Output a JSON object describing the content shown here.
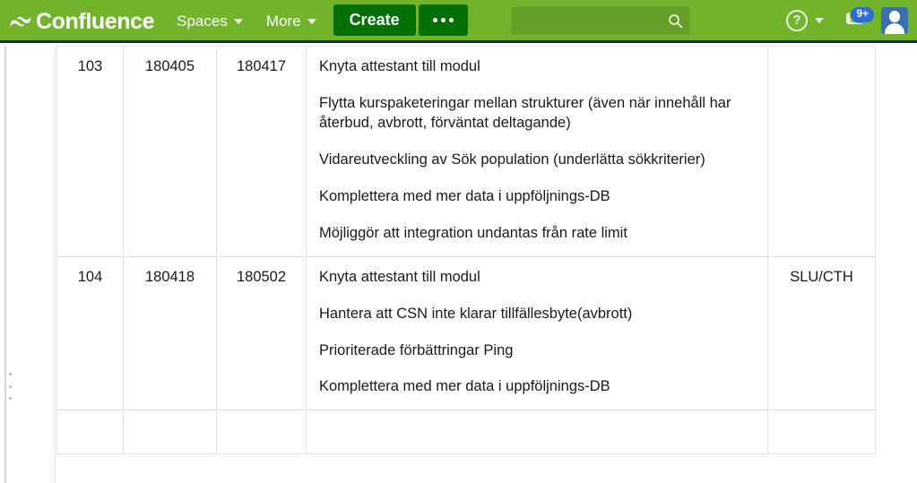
{
  "appbar": {
    "product_name": "Confluence",
    "logo_icon": "confluence-logo-icon",
    "nav": [
      {
        "label": "Spaces",
        "icon": "chevron-down-icon"
      },
      {
        "label": "More",
        "icon": "chevron-down-icon"
      }
    ],
    "create_label": "Create",
    "more_actions_icon": "ellipsis-icon",
    "search": {
      "value": "",
      "placeholder": "",
      "icon": "search-icon"
    },
    "help": {
      "glyph": "?",
      "icon": "help-icon",
      "caret_icon": "chevron-down-icon"
    },
    "notifications": {
      "icon": "notification-icon",
      "badge": "9+"
    },
    "profile": {
      "icon": "avatar-icon"
    },
    "colors": {
      "bar_background": "#71b32a",
      "button_background": "#046f05",
      "search_background": "#669f2a",
      "badge_background": "#2b6dd4",
      "avatar_background": "#3c6fad",
      "bar_bottom_border": "#172b4d"
    }
  },
  "sidebar": {
    "resize_handle_icon": "vertical-dots-handle-icon"
  },
  "table": {
    "rows": [
      {
        "number": "103",
        "start": "180405",
        "end": "180417",
        "items": [
          "Knyta attestant till modul",
          "Flytta kurspaketeringar mellan strukturer (även när innehåll har återbud, avbrott, förväntat deltagande)",
          "Vidareutveckling av Sök population (underlätta sökkriterier)",
          "Komplettera med mer data i uppföljnings-DB",
          "Möjliggör att integration undantas från rate limit"
        ],
        "org": ""
      },
      {
        "number": "104",
        "start": "180418",
        "end": "180502",
        "items": [
          "Knyta attestant till modul",
          "Hantera att CSN inte klarar tillfällesbyte(avbrott)",
          "Prioriterade förbättringar Ping",
          "Komplettera med mer data i uppföljnings-DB"
        ],
        "org": "SLU/CTH"
      },
      {
        "number": "",
        "start": "",
        "end": "",
        "items": [],
        "org": ""
      }
    ]
  }
}
